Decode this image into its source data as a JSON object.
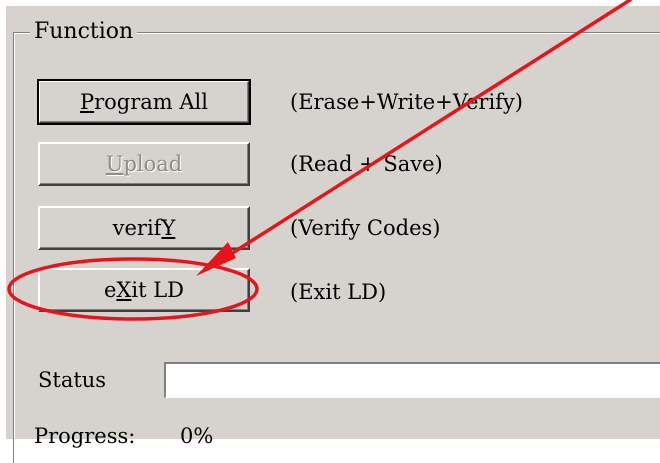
{
  "group": {
    "title": "Function"
  },
  "buttons": {
    "program_all": {
      "pre": "",
      "mnemonic": "P",
      "post": "rogram All",
      "disabled": false
    },
    "upload": {
      "pre": "",
      "mnemonic": "U",
      "post": "pload",
      "disabled": true
    },
    "verify": {
      "pre": "verif",
      "mnemonic": "Y",
      "post": "",
      "disabled": false
    },
    "exit_ld": {
      "pre": "e",
      "mnemonic": "X",
      "post": "it LD",
      "disabled": false
    }
  },
  "descriptions": {
    "program_all": "(Erase+Write+Verify)",
    "upload": "(Read + Save)",
    "verify": "(Verify Codes)",
    "exit_ld": "(Exit LD)"
  },
  "status": {
    "label": "Status",
    "value": ""
  },
  "progress": {
    "label": "Progress:",
    "value": "0%"
  },
  "annotation": {
    "arrow_color": "#e8141c",
    "ellipse_color": "#e8141c"
  },
  "colors": {
    "dialog_bg": "#d6d3ce",
    "disabled_text": "#8e8c88"
  }
}
